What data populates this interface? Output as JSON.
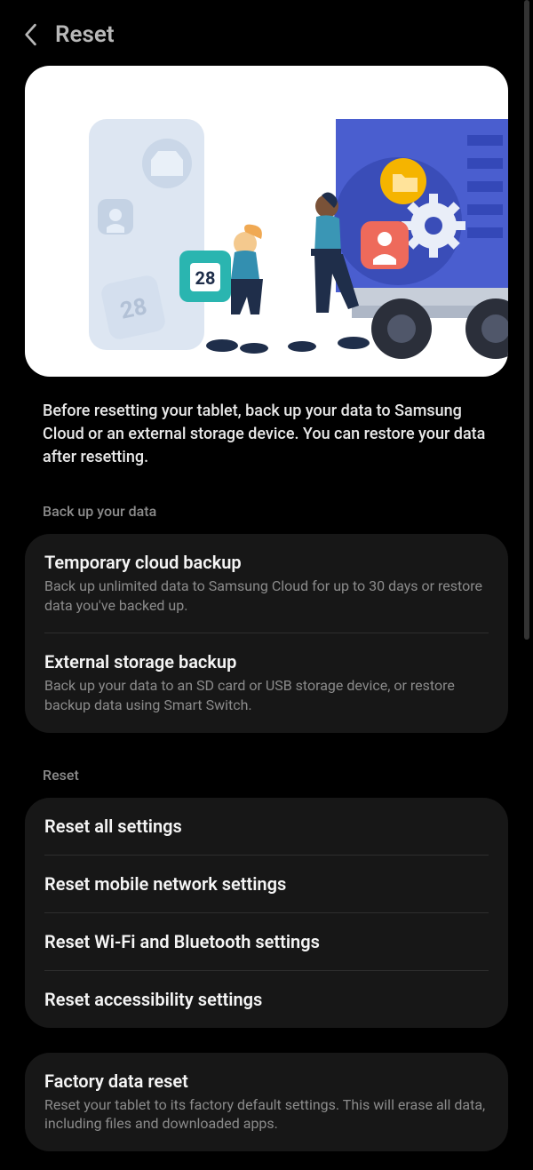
{
  "header": {
    "title": "Reset"
  },
  "intro": "Before resetting your tablet, back up your data to Samsung Cloud or an external storage device. You can restore your data after resetting.",
  "sections": {
    "backup": {
      "label": "Back up your data",
      "items": [
        {
          "title": "Temporary cloud backup",
          "sub": "Back up unlimited data to Samsung Cloud for up to 30 days or restore data you've backed up."
        },
        {
          "title": "External storage backup",
          "sub": "Back up your data to an SD card or USB storage device, or restore backup data using Smart Switch."
        }
      ]
    },
    "reset": {
      "label": "Reset",
      "items": [
        {
          "title": "Reset all settings"
        },
        {
          "title": "Reset mobile network settings"
        },
        {
          "title": "Reset Wi-Fi and Bluetooth settings"
        },
        {
          "title": "Reset accessibility settings"
        }
      ]
    },
    "factory": {
      "items": [
        {
          "title": "Factory data reset",
          "sub": "Reset your tablet to its factory default settings. This will erase all data, including files and downloaded apps."
        }
      ]
    }
  },
  "illustration": {
    "calendar_number": "28"
  }
}
